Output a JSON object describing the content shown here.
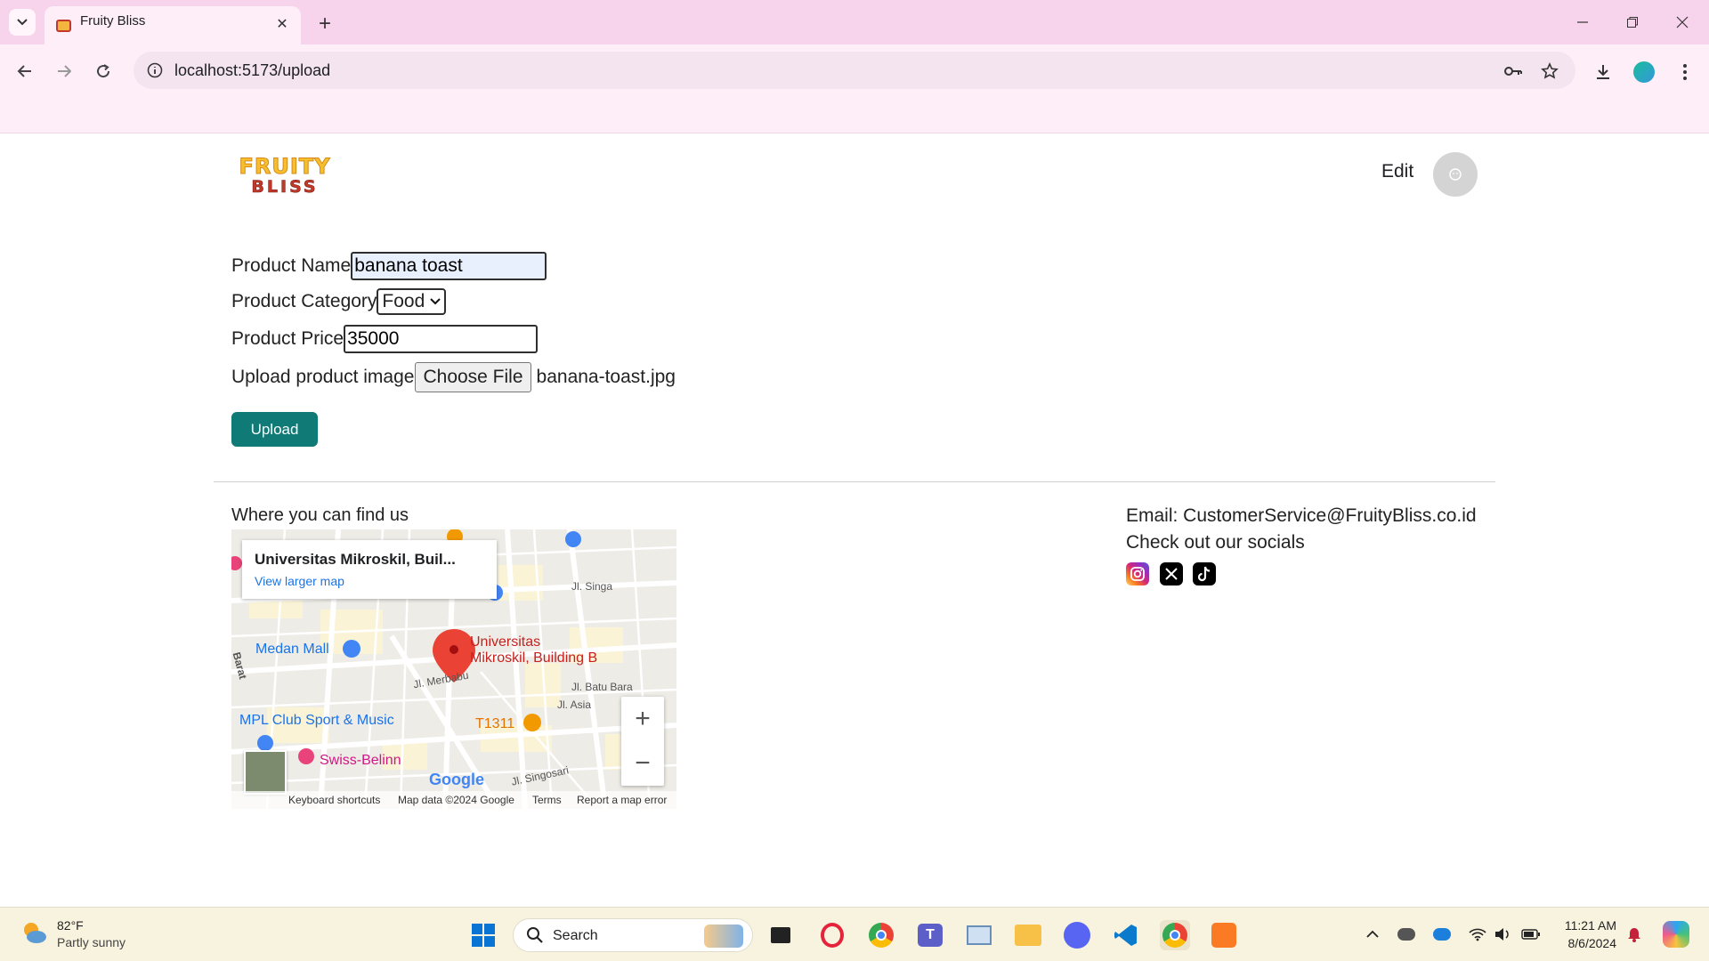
{
  "browser": {
    "tab_title": "Fruity Bliss",
    "url": "localhost:5173/upload"
  },
  "header": {
    "logo_line1": "FRUITY",
    "logo_line2": "BLISS",
    "edit_label": "Edit"
  },
  "form": {
    "name_label": "Product Name",
    "name_value": "banana toast",
    "category_label": "Product Category",
    "category_value": "Food",
    "price_label": "Product Price",
    "price_value": "35000",
    "image_label": "Upload product image",
    "choose_file_label": "Choose File",
    "file_name": "banana-toast.jpg",
    "upload_label": "Upload"
  },
  "footer": {
    "find_us": "Where you can find us",
    "email": "Email: CustomerService@FruityBliss.co.id",
    "socials_title": "Check out our socials",
    "socials": [
      "instagram",
      "x",
      "tiktok"
    ]
  },
  "map": {
    "place_title": "Universitas Mikroskil, Buil...",
    "view_larger": "View larger map",
    "marker_label_1": "Universitas",
    "marker_label_2": "Mikroskil, Building B",
    "poi_medan_mall": "Medan Mall",
    "poi_mpl": "MPL Club Sport & Music",
    "poi_t1311": "T1311",
    "poi_swiss": "Swiss-Belinn",
    "street_singa": "Jl. Singa",
    "street_batu_bara": "Jl. Batu Bara",
    "street_asia": "Jl. Asia",
    "street_singosari": "Jl. Singosari",
    "street_merbabu": "Jl. Merbabu",
    "street_barat": "Barat",
    "google": "Google",
    "keyboard_shortcuts": "Keyboard shortcuts",
    "map_data": "Map data ©2024 Google",
    "terms": "Terms",
    "report": "Report a map error"
  },
  "taskbar": {
    "weather_temp": "82°F",
    "weather_desc": "Partly sunny",
    "search_label": "Search",
    "time": "11:21 AM",
    "date": "8/6/2024"
  }
}
